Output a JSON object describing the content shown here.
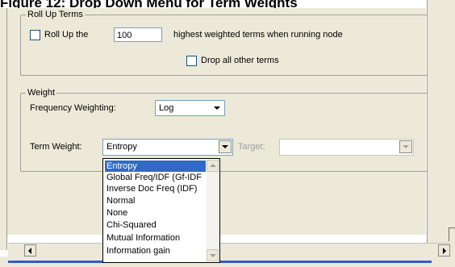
{
  "caption": "Figure 12: Drop Down Menu for Term Weights",
  "rollup": {
    "legend": "Roll Up Terms",
    "checkbox_label": "Roll Up the",
    "count_value": "100",
    "suffix_text": "highest weighted terms when running node",
    "drop_label": "Drop all other terms"
  },
  "weight": {
    "legend": "Weight",
    "freq_label": "Frequency Weighting:",
    "freq_value": "Log",
    "term_label": "Term Weight:",
    "term_value": "Entropy",
    "target_label": "Target:",
    "target_value": ""
  },
  "dropdown": {
    "selected": "Entropy",
    "options": [
      "Entropy",
      "Global Freq/IDF (Gf-IDF",
      "Inverse Doc Freq (IDF)",
      "Normal",
      "None",
      "Chi-Squared",
      "Mutual Information",
      "Information gain"
    ]
  },
  "colors": {
    "window_bg": "#ece9d8",
    "selection": "#316ac5",
    "field_border": "#7f9db9",
    "bottom_line": "#2f5bd0"
  },
  "icons": {
    "dropdown_arrow": "chevron-down-icon",
    "scroll_left": "arrow-left-icon",
    "scroll_right": "arrow-right-icon",
    "scroll_up": "arrow-up-icon",
    "scroll_down": "arrow-down-icon"
  }
}
